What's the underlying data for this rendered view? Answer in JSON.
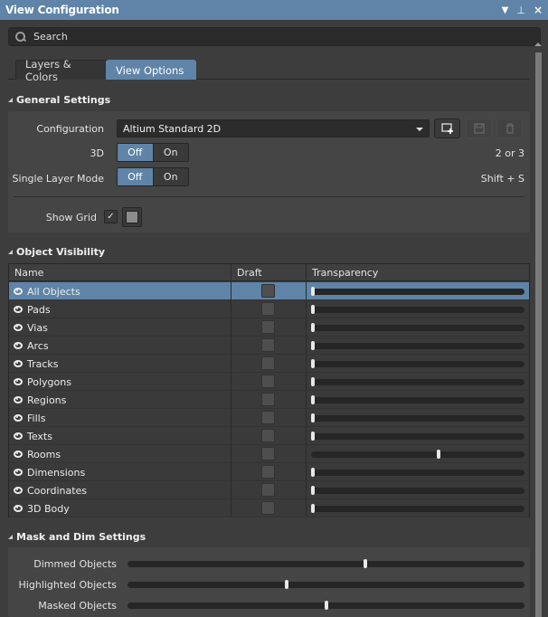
{
  "window": {
    "title": "View Configuration",
    "controls": [
      "dropdown",
      "pin",
      "close"
    ]
  },
  "search": {
    "placeholder": "Search",
    "value": ""
  },
  "tabs": [
    {
      "label": "Layers & Colors",
      "active": false
    },
    {
      "label": "View Options",
      "active": true
    }
  ],
  "general": {
    "heading": "General Settings",
    "configuration_label": "Configuration",
    "configuration_value": "Altium Standard 2D",
    "toggle_off": "Off",
    "toggle_on": "On",
    "three_d_label": "3D",
    "three_d_value": "Off",
    "three_d_shortcut": "2 or 3",
    "single_layer_label": "Single Layer Mode",
    "single_layer_value": "Off",
    "single_layer_shortcut": "Shift + S",
    "show_grid_label": "Show Grid",
    "show_grid_checked": true,
    "grid_color": "#8c8c8c"
  },
  "visibility": {
    "heading": "Object Visibility",
    "columns": [
      "Name",
      "Draft",
      "Transparency"
    ],
    "rows": [
      {
        "name": "All Objects",
        "draft": false,
        "transparency": 0,
        "selected": true
      },
      {
        "name": "Pads",
        "draft": false,
        "transparency": 0
      },
      {
        "name": "Vias",
        "draft": false,
        "transparency": 0
      },
      {
        "name": "Arcs",
        "draft": false,
        "transparency": 0
      },
      {
        "name": "Tracks",
        "draft": false,
        "transparency": 0
      },
      {
        "name": "Polygons",
        "draft": false,
        "transparency": 0
      },
      {
        "name": "Regions",
        "draft": false,
        "transparency": 0
      },
      {
        "name": "Fills",
        "draft": false,
        "transparency": 0
      },
      {
        "name": "Texts",
        "draft": false,
        "transparency": 0
      },
      {
        "name": "Rooms",
        "draft": false,
        "transparency": 0.6
      },
      {
        "name": "Dimensions",
        "draft": false,
        "transparency": 0
      },
      {
        "name": "Coordinates",
        "draft": false,
        "transparency": 0
      },
      {
        "name": "3D Body",
        "draft": false,
        "transparency": 0
      }
    ]
  },
  "mask": {
    "heading": "Mask and Dim Settings",
    "sliders": [
      {
        "label": "Dimmed Objects",
        "value": 0.6
      },
      {
        "label": "Highlighted Objects",
        "value": 0.4
      },
      {
        "label": "Masked Objects",
        "value": 0.5
      }
    ]
  },
  "colors": {
    "accent": "#5f84a8",
    "background": "#3d3d3d",
    "panel": "#454545"
  }
}
